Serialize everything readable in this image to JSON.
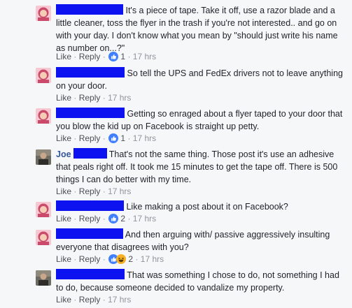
{
  "comments": [
    {
      "text": "It's a piece of tape. Take it off, use a razor blade and a little cleaner, toss the flyer in the trash if you're not interested.. and go on with your day. I don't know what you mean by \"should just write his name as number on...?\"",
      "like": "Like",
      "reply": "Reply",
      "reactions": "1",
      "time": "17 hrs",
      "avatar": "female-avatar",
      "reaction_icons": [
        "like-icon"
      ]
    },
    {
      "text": "So tell the UPS and FedEx drivers not to leave anything on your door.",
      "like": "Like",
      "reply": "Reply",
      "time": "17 hrs",
      "avatar": "female-avatar"
    },
    {
      "text": "Getting so enraged about a flyer taped to your door that you blow the kid up on Facebook is straight up petty.",
      "like": "Like",
      "reply": "Reply",
      "reactions": "1",
      "time": "17 hrs",
      "avatar": "female-avatar",
      "reaction_icons": [
        "like-icon"
      ]
    },
    {
      "author": "Joe",
      "text": "That's not the same thing. Those post it's use an adhesive that peals right off. It took me 15 minutes to get the tape off. There is 500 things I can do better with my time.",
      "like": "Like",
      "reply": "Reply",
      "time": "17 hrs",
      "avatar": "male-avatar"
    },
    {
      "text": "Like making a post about it on Facebook?",
      "like": "Like",
      "reply": "Reply",
      "reactions": "2",
      "time": "17 hrs",
      "avatar": "female-avatar",
      "reaction_icons": [
        "like-icon"
      ]
    },
    {
      "text": "And then arguing with/ passive aggressively insulting everyone that disagrees with you?",
      "like": "Like",
      "reply": "Reply",
      "reactions": "2",
      "time": "17 hrs",
      "avatar": "female-avatar",
      "reaction_icons": [
        "like-icon",
        "haha-icon"
      ]
    },
    {
      "text": "That was something I chose to do, not something I had to do, because someone decided to vandalize my property.",
      "like": "Like",
      "reply": "Reply",
      "time": "17 hrs",
      "avatar": "male-avatar"
    }
  ],
  "colors": {
    "redaction": "#0d13f0",
    "link": "#365899",
    "like_blue": "#4080ff",
    "haha_yellow": "#f7b125"
  }
}
